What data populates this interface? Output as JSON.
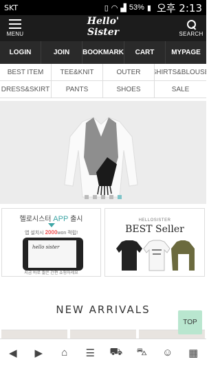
{
  "status_bar": {
    "carrier": "SKT",
    "battery": "53%",
    "time": "오후 2:13"
  },
  "header": {
    "menu_label": "MENU",
    "logo_line1": "Hello'",
    "logo_line2": "Sister",
    "search_label": "SEARCH"
  },
  "topnav": [
    "LOGIN",
    "JOIN",
    "BOOKMARK",
    "CART",
    "MYPAGE"
  ],
  "categories": [
    "BEST ITEM",
    "TEE&KNIT",
    "OUTER",
    "SHIRTS&BLOUSE",
    "DRESS&SKIRT",
    "PANTS",
    "SHOES",
    "SALE"
  ],
  "banner": {
    "dot_count": 5,
    "active_dot": 4
  },
  "promo_app": {
    "title_prefix": "헬로시스터 ",
    "title_app": "APP",
    "title_suffix": " 출시",
    "sub_prefix": "앱 설치시 ",
    "sub_amount": "2000",
    "sub_suffix": "won 적립!",
    "caption": "지금 바로 짧은 간편 쇼핑하세요"
  },
  "promo_best": {
    "small": "HELLOSISTER",
    "big": "BEST Seller"
  },
  "section_title": "NEW ARRIVALS",
  "top_button": "TOP",
  "bottom_nav_icons": [
    "back-arrow-icon",
    "forward-arrow-icon",
    "home-icon",
    "list-icon",
    "cart-icon",
    "delivery-truck-icon",
    "my-account-icon",
    "grid-menu-icon"
  ]
}
